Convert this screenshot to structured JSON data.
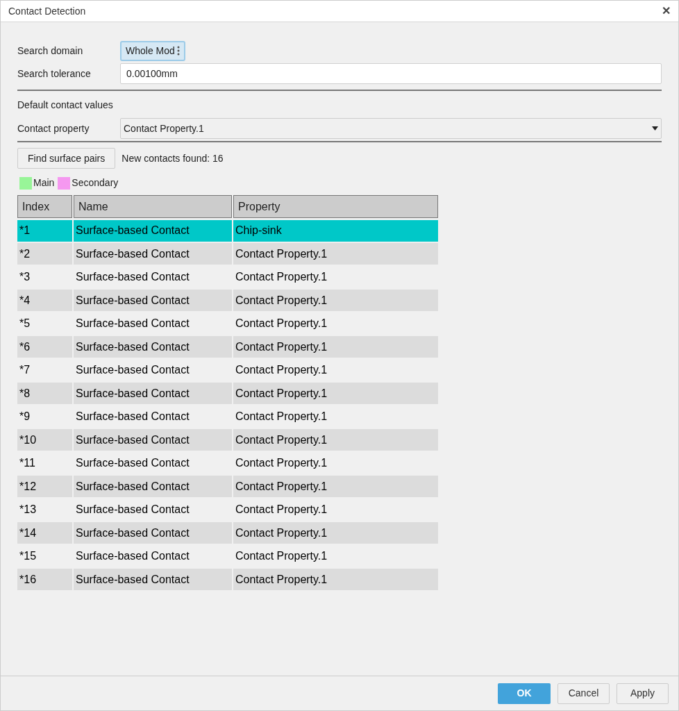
{
  "window": {
    "title": "Contact Detection",
    "close": "✕"
  },
  "search_domain": {
    "label": "Search domain",
    "value": "Whole Mod"
  },
  "search_tolerance": {
    "label": "Search tolerance",
    "value": "0.00100mm"
  },
  "section_title": "Default contact values",
  "contact_property": {
    "label": "Contact property",
    "value": "Contact Property.1"
  },
  "find_button": "Find surface pairs",
  "status": "New contacts found: 16",
  "legend": [
    {
      "label": "Main",
      "color": "#98f598"
    },
    {
      "label": "Secondary",
      "color": "#f598f0"
    }
  ],
  "table": {
    "columns": [
      "Index",
      "Name",
      "Property"
    ],
    "rows": [
      {
        "index": "*1",
        "name": "Surface-based Contact",
        "property": "Chip-sink",
        "selected": true
      },
      {
        "index": "*2",
        "name": "Surface-based Contact",
        "property": "Contact Property.1",
        "selected": false
      },
      {
        "index": "*3",
        "name": "Surface-based Contact",
        "property": "Contact Property.1",
        "selected": false
      },
      {
        "index": "*4",
        "name": "Surface-based Contact",
        "property": "Contact Property.1",
        "selected": false
      },
      {
        "index": "*5",
        "name": "Surface-based Contact",
        "property": "Contact Property.1",
        "selected": false
      },
      {
        "index": "*6",
        "name": "Surface-based Contact",
        "property": "Contact Property.1",
        "selected": false
      },
      {
        "index": "*7",
        "name": "Surface-based Contact",
        "property": "Contact Property.1",
        "selected": false
      },
      {
        "index": "*8",
        "name": "Surface-based Contact",
        "property": "Contact Property.1",
        "selected": false
      },
      {
        "index": "*9",
        "name": "Surface-based Contact",
        "property": "Contact Property.1",
        "selected": false
      },
      {
        "index": "*10",
        "name": "Surface-based Contact",
        "property": "Contact Property.1",
        "selected": false
      },
      {
        "index": "*11",
        "name": "Surface-based Contact",
        "property": "Contact Property.1",
        "selected": false
      },
      {
        "index": "*12",
        "name": "Surface-based Contact",
        "property": "Contact Property.1",
        "selected": false
      },
      {
        "index": "*13",
        "name": "Surface-based Contact",
        "property": "Contact Property.1",
        "selected": false
      },
      {
        "index": "*14",
        "name": "Surface-based Contact",
        "property": "Contact Property.1",
        "selected": false
      },
      {
        "index": "*15",
        "name": "Surface-based Contact",
        "property": "Contact Property.1",
        "selected": false
      },
      {
        "index": "*16",
        "name": "Surface-based Contact",
        "property": "Contact Property.1",
        "selected": false
      }
    ]
  },
  "buttons": [
    {
      "label": "OK",
      "kind": "primary"
    },
    {
      "label": "Cancel",
      "kind": "secondary"
    },
    {
      "label": "Apply",
      "kind": "secondary"
    }
  ]
}
